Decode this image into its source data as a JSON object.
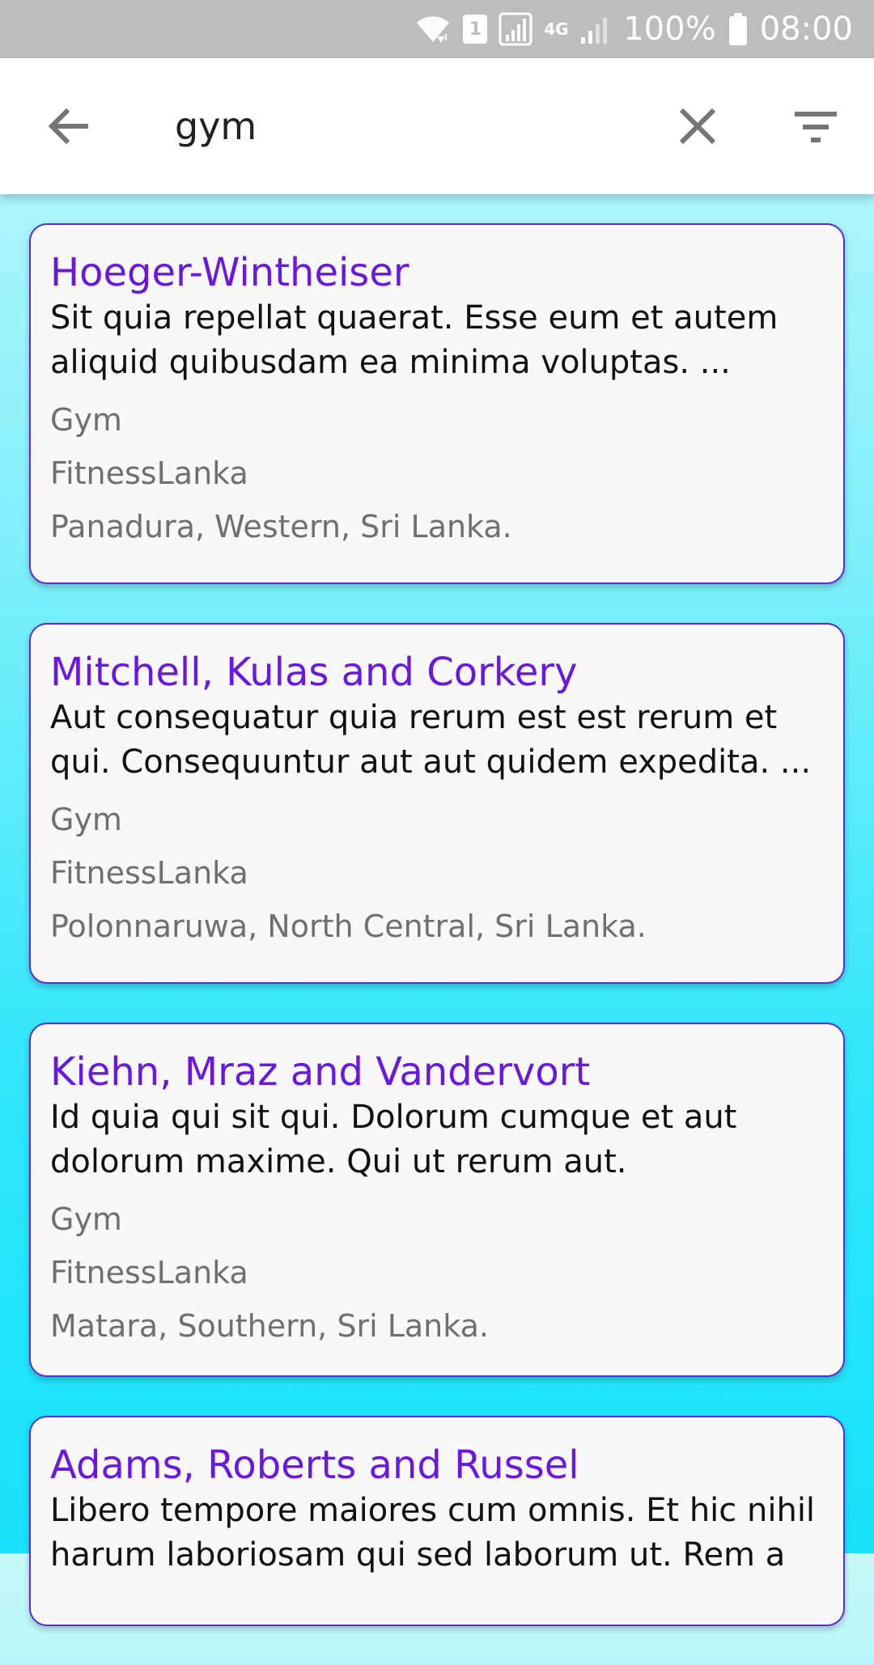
{
  "status_bar": {
    "sim_slot": "1",
    "network_type": "4G",
    "battery": "100%",
    "time": "08:00",
    "icons": [
      "wifi-icon",
      "sim-icon",
      "signal-icon",
      "network-4g-icon",
      "signal-weak-icon",
      "battery-icon"
    ]
  },
  "search": {
    "query": "gym",
    "icons": [
      "back-arrow-icon",
      "clear-icon",
      "filter-icon"
    ]
  },
  "results": [
    {
      "title": "Hoeger-Wintheiser",
      "description": "Sit quia repellat quaerat. Esse eum et autem aliquid quibusdam ea minima voluptas. ...",
      "category": "Gym",
      "provider": "FitnessLanka",
      "location": "Panadura, Western, Sri Lanka."
    },
    {
      "title": "Mitchell, Kulas and Corkery",
      "description": "Aut consequatur quia rerum est est rerum et qui. Consequuntur aut aut quidem expedita. ...",
      "category": "Gym",
      "provider": "FitnessLanka",
      "location": "Polonnaruwa, North Central, Sri Lanka."
    },
    {
      "title": "Kiehn, Mraz and Vandervort",
      "description": "Id quia qui sit qui. Dolorum cumque et aut dolorum maxime. Qui ut rerum aut.",
      "category": "Gym",
      "provider": "FitnessLanka",
      "location": "Matara, Southern, Sri Lanka."
    },
    {
      "title": "Adams, Roberts and Russel",
      "description": "Libero tempore maiores cum omnis. Et hic nihil harum laboriosam qui sed laborum ut. Rem a",
      "category": "",
      "provider": "",
      "location": ""
    }
  ],
  "colors": {
    "title": "#6a17e0",
    "card_border": "#5b2bd8",
    "status_bar": "#bdbdbd"
  }
}
